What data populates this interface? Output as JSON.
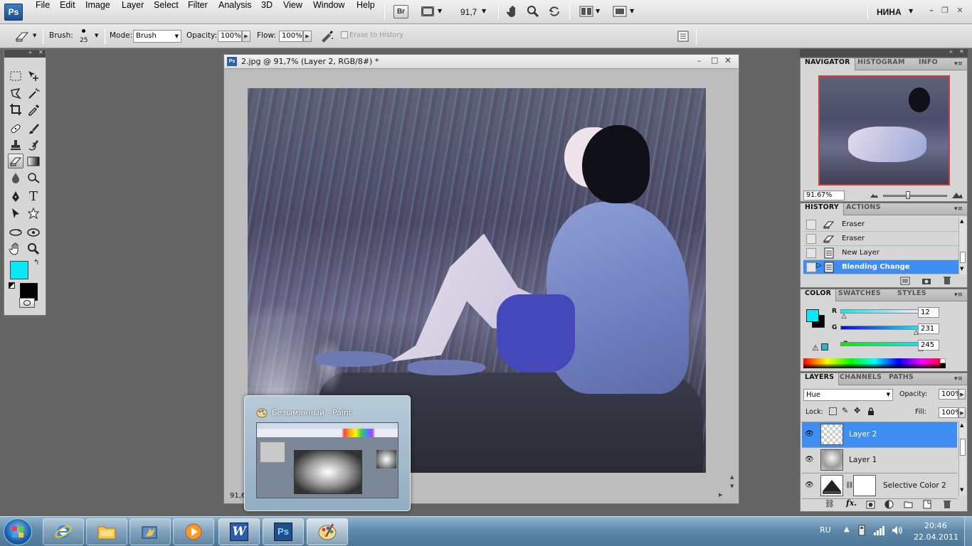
{
  "app": {
    "logo": "Ps",
    "user": "НИНА"
  },
  "menu": [
    "File",
    "Edit",
    "Image",
    "Layer",
    "Select",
    "Filter",
    "Analysis",
    "3D",
    "View",
    "Window",
    "Help"
  ],
  "appbar": {
    "bridge": "Br",
    "zoom": "91,7"
  },
  "options": {
    "brush_label": "Brush:",
    "brush_size": "25",
    "mode_label": "Mode:",
    "mode_value": "Brush",
    "opacity_label": "Opacity:",
    "opacity_value": "100%",
    "flow_label": "Flow:",
    "flow_value": "100%",
    "erase_history": "Erase to History"
  },
  "document": {
    "title": "2.jpg @ 91,7% (Layer 2, RGB/8#) *",
    "zoom_status": "91,6"
  },
  "colors": {
    "foreground": "#0ce7f5",
    "background": "#000000",
    "highlight": "#3d8ef0"
  },
  "navigator": {
    "tabs": [
      "NAVIGATOR",
      "HISTOGRAM",
      "INFO"
    ],
    "zoom": "91.67%"
  },
  "history": {
    "tabs": [
      "HISTORY",
      "ACTIONS"
    ],
    "items": [
      {
        "label": "Eraser",
        "icon": "eraser-icon"
      },
      {
        "label": "Eraser",
        "icon": "eraser-icon"
      },
      {
        "label": "New Layer",
        "icon": "document-icon"
      },
      {
        "label": "Blending Change",
        "icon": "document-icon"
      }
    ]
  },
  "color_panel": {
    "tabs": [
      "COLOR",
      "SWATCHES",
      "STYLES"
    ],
    "r": {
      "label": "R",
      "value": "12"
    },
    "g": {
      "label": "G",
      "value": "231"
    },
    "b": {
      "label": "B",
      "value": "245"
    }
  },
  "layers": {
    "tabs": [
      "LAYERS",
      "CHANNELS",
      "PATHS"
    ],
    "blend_mode": "Hue",
    "opacity_label": "Opacity:",
    "opacity_value": "100%",
    "lock_label": "Lock:",
    "fill_label": "Fill:",
    "fill_value": "100%",
    "items": [
      "Layer 2",
      "Layer 1",
      "Selective Color 2"
    ]
  },
  "popup": {
    "title": "Безымянный - Paint"
  },
  "taskbar": {
    "lang": "RU",
    "time": "20:46",
    "date": "22.04.2011"
  }
}
